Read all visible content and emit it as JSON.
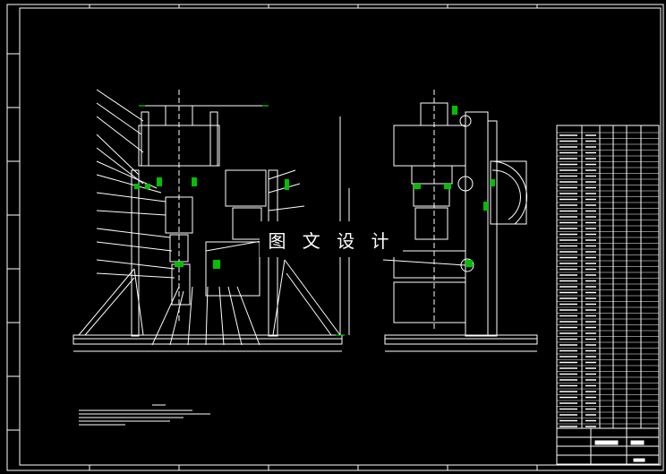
{
  "watermark": {
    "text": "图 文 设 计"
  },
  "colors": {
    "background": "#000000",
    "line": "#ffffff",
    "accent_green": "#00c000",
    "dimension_green": "#00ff00"
  }
}
